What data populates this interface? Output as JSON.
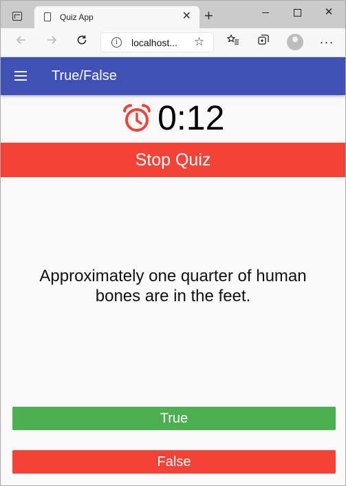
{
  "browser": {
    "tab_title": "Quiz App",
    "tab_close": "✕",
    "new_tab": "+",
    "address": "localhost...",
    "back_icon": "back-arrow-icon",
    "forward_icon": "forward-arrow-icon",
    "reload_icon": "reload-icon",
    "more": "···"
  },
  "app": {
    "title": "True/False",
    "menu_icon": "hamburger-menu-icon"
  },
  "timer": {
    "icon": "alarm-clock-icon",
    "value": "0:12"
  },
  "stop_button": "Stop Quiz",
  "question": "Approximately one quarter of human bones are in the feet.",
  "answers": {
    "true_label": "True",
    "false_label": "False"
  },
  "colors": {
    "app_bar": "#3f51b5",
    "stop": "#f44336",
    "true": "#4caf50",
    "false": "#f44336"
  }
}
